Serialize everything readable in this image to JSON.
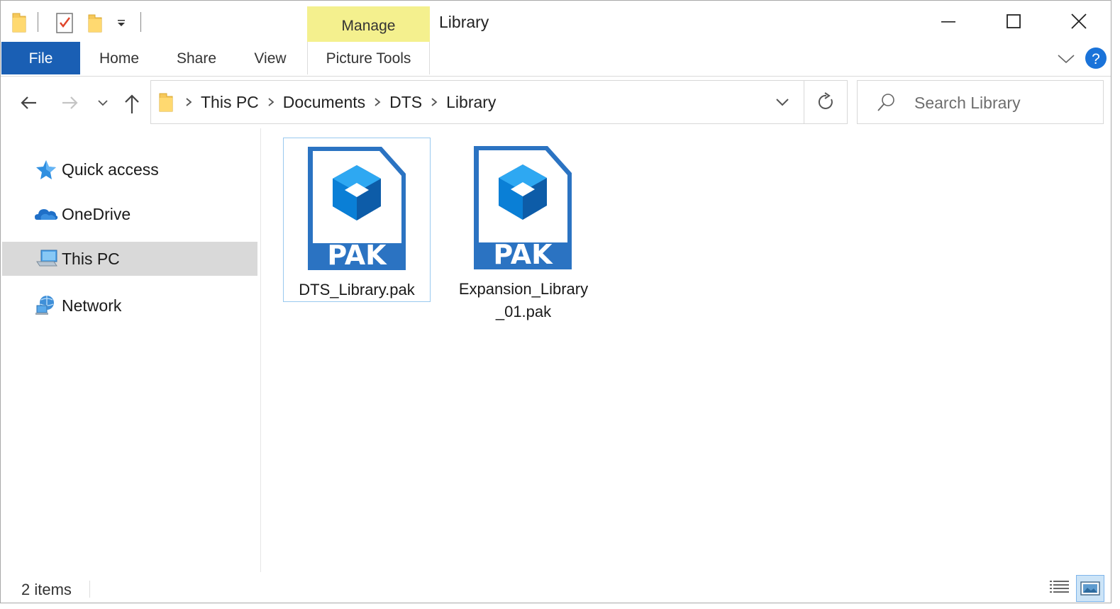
{
  "window": {
    "title": "Library",
    "contextual_group": "Manage"
  },
  "ribbon": {
    "tabs": [
      {
        "label": "File"
      },
      {
        "label": "Home"
      },
      {
        "label": "Share"
      },
      {
        "label": "View"
      },
      {
        "label": "Picture Tools"
      }
    ]
  },
  "address": {
    "crumbs": [
      "This PC",
      "Documents",
      "DTS",
      "Library"
    ]
  },
  "search": {
    "placeholder": "Search Library"
  },
  "nav": {
    "items": [
      {
        "label": "Quick access",
        "icon": "star-icon"
      },
      {
        "label": "OneDrive",
        "icon": "cloud-icon"
      },
      {
        "label": "This PC",
        "icon": "computer-icon",
        "selected": true
      },
      {
        "label": "Network",
        "icon": "network-icon"
      }
    ]
  },
  "files": [
    {
      "name": "DTS_Library.pak",
      "badge": "PAK",
      "selected": true
    },
    {
      "name": "Expansion_Library_01.pak",
      "badge": "PAK",
      "selected": false
    }
  ],
  "status": {
    "item_count": "2 items"
  },
  "colors": {
    "file_tab": "#1a5fb4",
    "manage_tab": "#f4f08e",
    "pak_blue": "#2b73c2"
  }
}
